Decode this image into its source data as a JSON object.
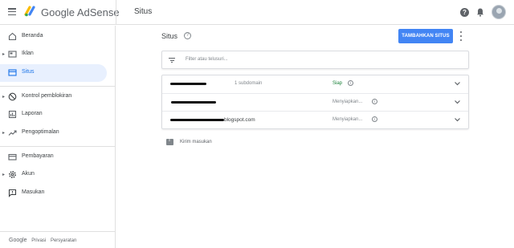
{
  "topbar": {
    "brand_google": "Google",
    "brand_product": "AdSense",
    "page_heading": "Situs",
    "icons": [
      "menu-icon",
      "adsense-logo-icon",
      "help-icon",
      "notifications-icon",
      "avatar"
    ]
  },
  "sidebar": {
    "items": [
      {
        "label": "Beranda",
        "icon": "home-icon",
        "expandable": false,
        "active": false
      },
      {
        "label": "Iklan",
        "icon": "ads-icon",
        "expandable": true,
        "active": false
      },
      {
        "label": "Situs",
        "icon": "sites-icon",
        "expandable": false,
        "active": true
      },
      {
        "label": "Kontrol pemblokiran",
        "icon": "block-icon",
        "expandable": true,
        "active": false
      },
      {
        "label": "Laporan",
        "icon": "reports-icon",
        "expandable": false,
        "active": false
      },
      {
        "label": "Pengoptimalan",
        "icon": "trending-icon",
        "expandable": true,
        "active": false
      },
      {
        "label": "Pembayaran",
        "icon": "payments-icon",
        "expandable": false,
        "active": false
      },
      {
        "label": "Akun",
        "icon": "settings-icon",
        "expandable": true,
        "active": false
      },
      {
        "label": "Masukan",
        "icon": "feedback-icon",
        "expandable": false,
        "active": false
      }
    ],
    "footer": {
      "google": "Google",
      "privacy": "Privasi",
      "terms": "Persyaratan"
    }
  },
  "main": {
    "title": "Situs",
    "add_button": "TAMBAHKAN SITUS",
    "filter_placeholder": "Filter atau telusuri...",
    "sites": [
      {
        "name": "",
        "extra": "1 subdomain",
        "status": "Siap",
        "status_color": "#188038"
      },
      {
        "name": "",
        "extra": "",
        "status": "Menyiapkan...",
        "status_color": "#80868b"
      },
      {
        "name": "blogspot.com",
        "extra": "",
        "status": "Menyiapkan...",
        "status_color": "#80868b"
      }
    ],
    "feedback_label": "Kirim masukan"
  },
  "colors": {
    "accent": "#4285f4",
    "active_nav_bg": "#e8f0fe",
    "active_nav_text": "#1a73e8",
    "ready_status": "#188038"
  }
}
